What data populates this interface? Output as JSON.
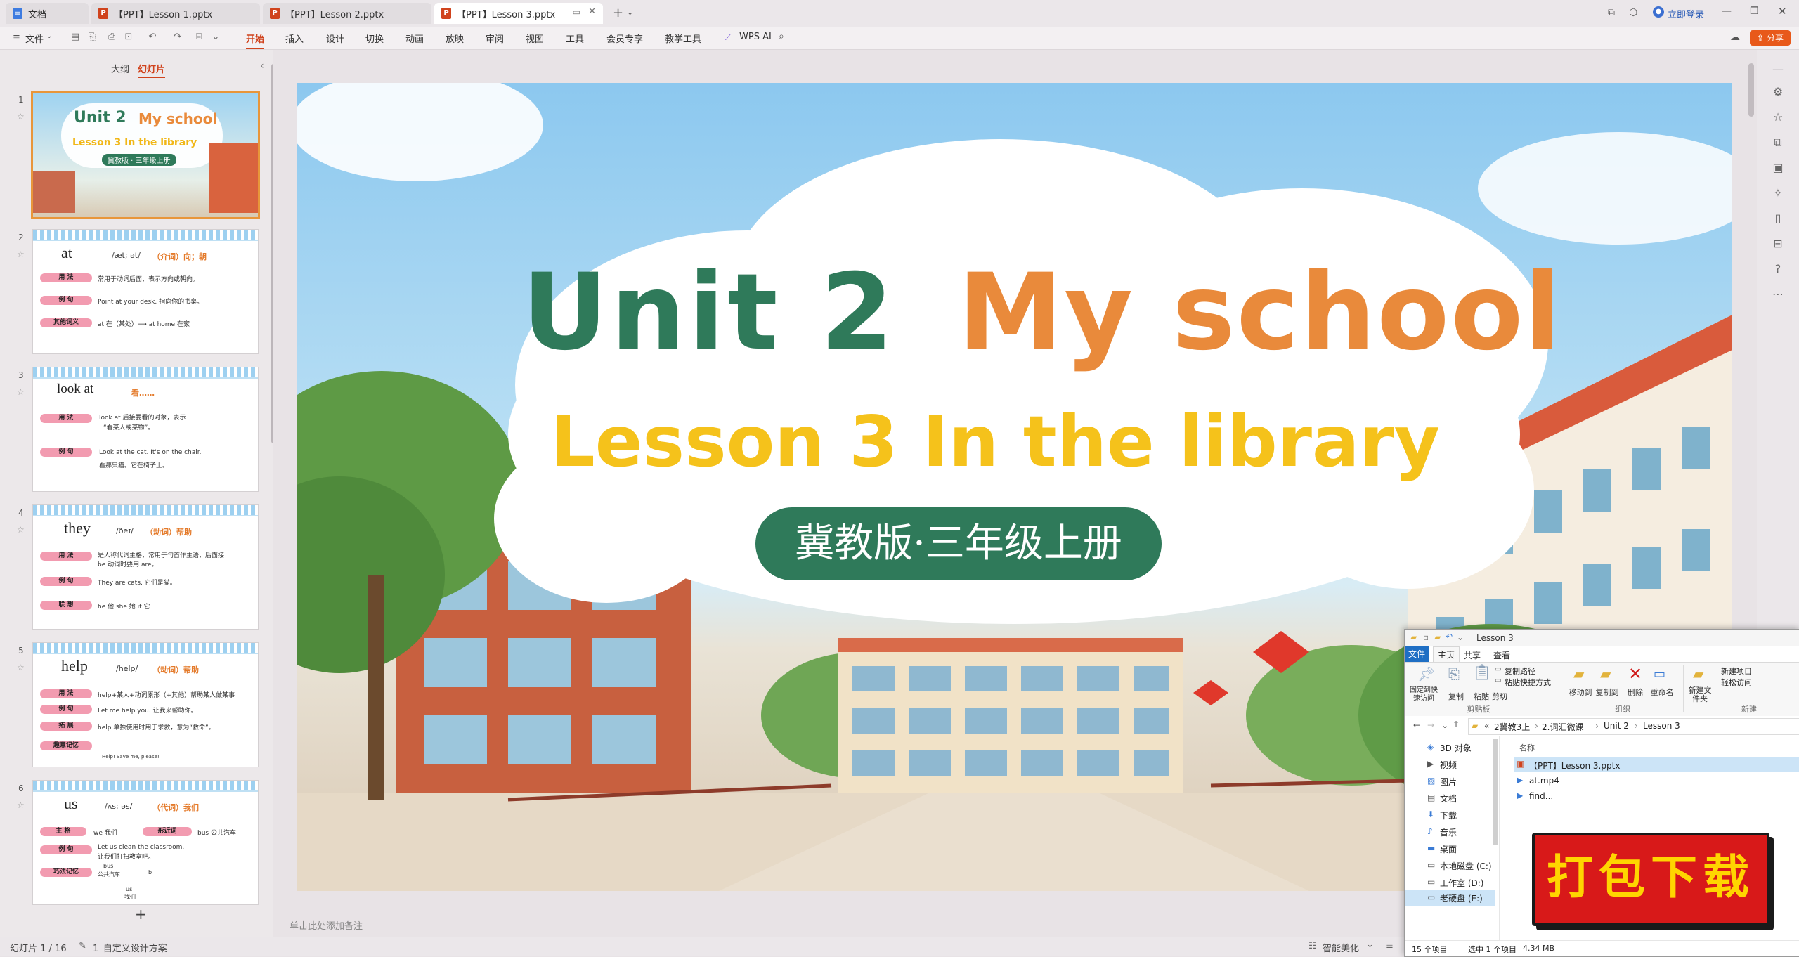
{
  "tabs": [
    {
      "label": "文档",
      "icon": "doc-icon"
    },
    {
      "label": "【PPT】Lesson 1.pptx",
      "icon": "ppt-icon"
    },
    {
      "label": "【PPT】Lesson 2.pptx",
      "icon": "ppt-icon"
    },
    {
      "label": "【PPT】Lesson 3.pptx",
      "icon": "ppt-icon"
    }
  ],
  "titlebar": {
    "login": "立即登录",
    "share": "分享"
  },
  "menu": {
    "file": "文件",
    "items": [
      "开始",
      "插入",
      "设计",
      "切换",
      "动画",
      "放映",
      "审阅",
      "视图",
      "工具",
      "会员专享",
      "教学工具"
    ],
    "active": "开始",
    "ai": "WPS AI"
  },
  "panel": {
    "outline": "大纲",
    "slides": "幻灯片"
  },
  "thumbs": {
    "numbers": [
      "1",
      "2",
      "3",
      "4",
      "5",
      "6"
    ],
    "t1": {
      "unit": "Unit 2",
      "school": "My school",
      "lesson": "Lesson 3 In the library",
      "edition": "冀教版 · 三年级上册"
    },
    "t2": {
      "word": "at",
      "phon": "/æt; ət/",
      "pos": "（介词）向；朝",
      "tags": [
        "用 法",
        "例 句",
        "其他词义"
      ],
      "lines": [
        "常用于动词后面，表示方向或朝向。",
        "Point at your desk. 指向你的书桌。",
        "at 在（某处）⟶ at home 在家"
      ]
    },
    "t3": {
      "word": "look at",
      "pos": "看……",
      "tags": [
        "用 法",
        "例 句"
      ],
      "lines": [
        "look at 后接要看的对象，表示",
        "“看某人或某物”。",
        "Look at the cat. It's on the chair.",
        "看那只猫。它在椅子上。"
      ]
    },
    "t4": {
      "word": "they",
      "phon": "/ðeɪ/",
      "pos": "（动词）帮助",
      "tags": [
        "用 法",
        "例 句",
        "联 想"
      ],
      "lines": [
        "是人称代词主格，常用于句首作主语，后面接",
        "be 动词时要用 are。",
        "They are cats. 它们是猫。",
        "he 他      she 她      it 它"
      ]
    },
    "t5": {
      "word": "help",
      "phon": "/help/",
      "pos": "（动词）帮助",
      "tags": [
        "用 法",
        "例 句",
        "拓 展",
        "趣意记忆"
      ],
      "lines": [
        "help+某人+动词原形（+其他）帮助某人做某事",
        "Let me help you. 让我来帮助你。",
        "help 单独使用时用于求救，意为“救命”。",
        "Help! Save me, please!"
      ]
    },
    "t6": {
      "word": "us",
      "phon": "/ʌs; əs/",
      "pos": "（代词）我们",
      "tags": [
        "主 格",
        "形近词",
        "例 句",
        "巧法记忆"
      ],
      "lines": [
        "we 我们",
        "bus 公共汽车",
        "Let us clean the classroom.",
        "让我们打扫教室吧。",
        "bus",
        "公共汽车",
        "b",
        "us",
        "我们"
      ]
    }
  },
  "slide": {
    "unit": "Unit 2",
    "school": "My school",
    "lesson": "Lesson 3 In the library",
    "edition": "冀教版·三年级上册"
  },
  "notes_placeholder": "单击此处添加备注",
  "status": {
    "slide_index": "幻灯片 1 / 16",
    "design": "1_自定义设计方案",
    "beautify": "智能美化"
  },
  "explorer": {
    "title": "Lesson 3",
    "ribbon_tabs": [
      "文件",
      "主页",
      "共享",
      "查看"
    ],
    "clipboard": {
      "pin": "固定到快速访问",
      "copy": "复制",
      "paste": "粘贴",
      "copy_path": "复制路径",
      "paste_shortcut": "粘贴快捷方式",
      "cut": "剪切",
      "group": "剪贴板"
    },
    "organize": {
      "move": "移动到",
      "copy_to": "复制到",
      "delete": "删除",
      "rename": "重命名",
      "group": "组织"
    },
    "new_group": {
      "new_folder": "新建文件夹",
      "new_item": "新建项目",
      "easy_access": "轻松访问",
      "group": "新建"
    },
    "breadcrumb": [
      "«",
      "2冀教3上",
      "2.词汇微课",
      "Unit 2",
      "Lesson 3"
    ],
    "nav": [
      "3D 对象",
      "视频",
      "图片",
      "文档",
      "下载",
      "音乐",
      "桌面",
      "本地磁盘 (C:)",
      "工作室 (D:)",
      "老硬盘 (E:)"
    ],
    "column": "名称",
    "files": [
      "【PPT】Lesson 3.pptx",
      "at.mp4",
      "find..."
    ],
    "status_items": "15 个项目",
    "status_selected": "选中 1 个项目",
    "status_size": "4.34 MB"
  },
  "download_badge": "打包下载",
  "colors": {
    "accent": "#d0431d",
    "unit_green": "#2f7a5a",
    "school_orange": "#e98a3b",
    "lesson_yellow": "#f5c21b",
    "badge_red": "#d81919"
  }
}
